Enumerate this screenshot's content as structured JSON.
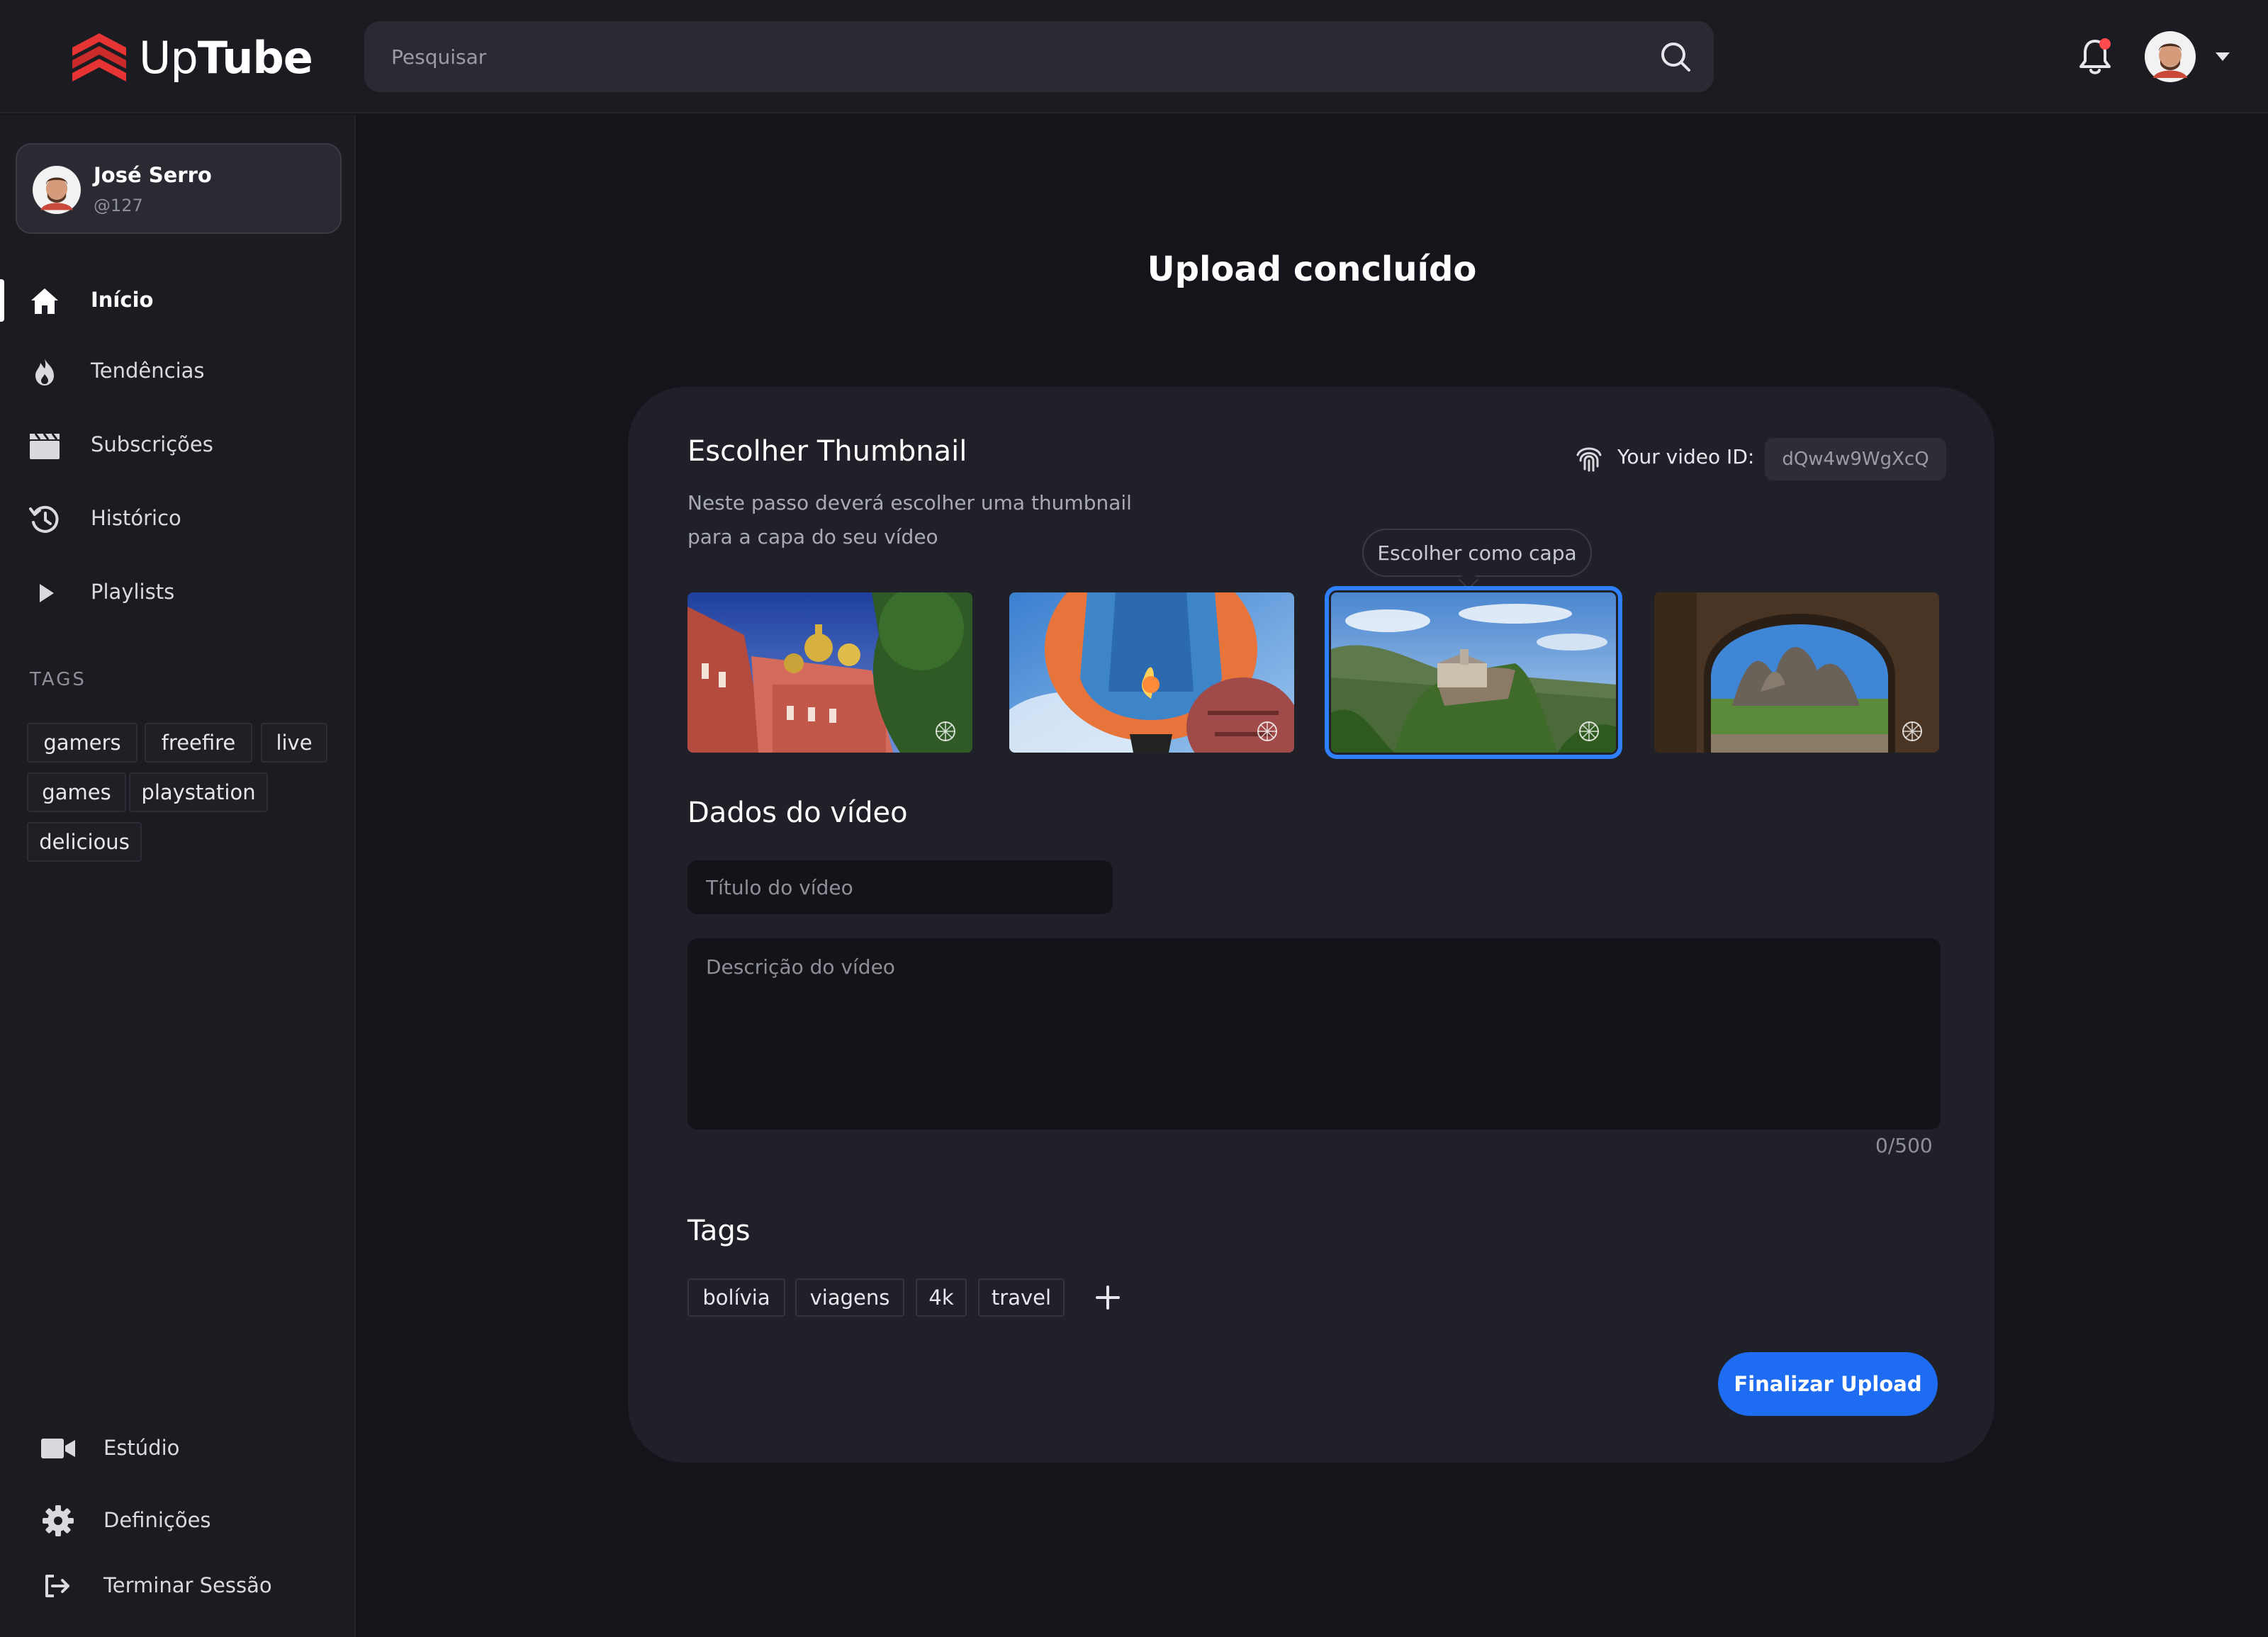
{
  "brand": {
    "name_part1": "Up",
    "name_part2": "Tube",
    "accent": "#e63333"
  },
  "search": {
    "placeholder": "Pesquisar"
  },
  "header": {
    "notification_icon": "bell-icon",
    "has_notification": true
  },
  "user": {
    "name": "José Serro",
    "handle": "@127"
  },
  "nav": [
    {
      "label": "Início",
      "icon": "home-icon",
      "active": true
    },
    {
      "label": "Tendências",
      "icon": "flame-icon"
    },
    {
      "label": "Subscrições",
      "icon": "clapperboard-icon"
    },
    {
      "label": "Histórico",
      "icon": "history-icon"
    },
    {
      "label": "Playlists",
      "icon": "play-icon"
    }
  ],
  "sidebar_tags": {
    "title": "TAGS",
    "items": [
      "gamers",
      "freefire",
      "live",
      "games",
      "playstation",
      "delicious"
    ]
  },
  "footer_nav": [
    {
      "label": "Estúdio",
      "icon": "video-camera-icon"
    },
    {
      "label": "Definições",
      "icon": "gear-icon"
    },
    {
      "label": "Terminar Sessão",
      "icon": "logout-icon"
    }
  ],
  "page": {
    "title": "Upload concluído"
  },
  "thumbnail_section": {
    "title": "Escolher Thumbnail",
    "description_line1": "Neste passo deverá escolher uma thumbnail",
    "description_line2": "para a capa do seu vídeo",
    "video_id_label": "Your video ID:",
    "video_id": "dQw4w9WgXcQ",
    "tooltip": "Escolher como capa",
    "selected_index": 2,
    "thumbnails": [
      "church-domes-image",
      "hot-air-balloon-image",
      "cliff-monastery-image",
      "rock-arch-landscape-image"
    ]
  },
  "video_data": {
    "title": "Dados do vídeo",
    "title_placeholder": "Título do vídeo",
    "description_placeholder": "Descrição do vídeo",
    "counter": "0/500"
  },
  "tags_section": {
    "title": "Tags",
    "items": [
      "bolívia",
      "viagens",
      "4k",
      "travel"
    ]
  },
  "actions": {
    "finish_label": "Finalizar Upload",
    "finish_color": "#1d6cf2"
  }
}
